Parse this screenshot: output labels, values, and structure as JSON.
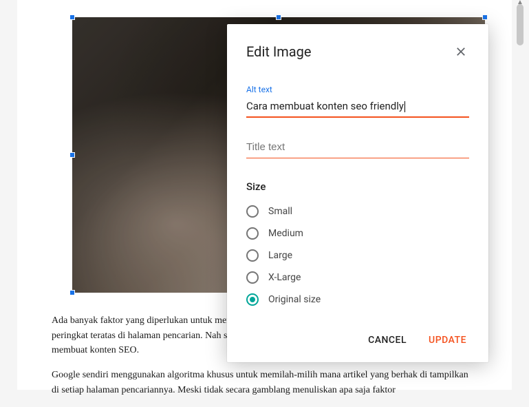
{
  "dialog": {
    "title": "Edit Image",
    "altText": {
      "label": "Alt text",
      "value": "Cara membuat konten seo friendly"
    },
    "titleText": {
      "placeholder": "Title text",
      "value": ""
    },
    "sizeSection": {
      "label": "Size",
      "options": [
        {
          "label": "Small",
          "checked": false
        },
        {
          "label": "Medium",
          "checked": false
        },
        {
          "label": "Large",
          "checked": false
        },
        {
          "label": "X-Large",
          "checked": false
        },
        {
          "label": "Original size",
          "checked": true
        }
      ]
    },
    "actions": {
      "cancel": "CANCEL",
      "update": "UPDATE"
    }
  },
  "article": {
    "p1": "Ada banyak faktor yang diperlukan untuk membuat artikel konten dalam sebuah website menduduki peringkat teratas di halaman pencarian. Nah salah satu upaya untuk mencapai posisi tersebut adalah dengan membuat konten SEO.",
    "p2": "Google sendiri menggunakan algoritma khusus untuk memilah-milih mana artikel yang berhak di tampilkan di setiap halaman pencariannya. Meski tidak secara gamblang menuliskan apa saja faktor"
  }
}
